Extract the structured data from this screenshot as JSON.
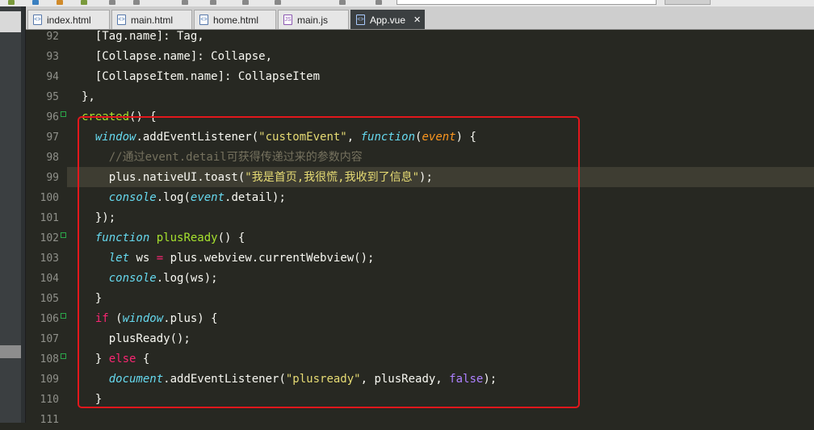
{
  "tabs": [
    {
      "label": "index.html",
      "kind": "html"
    },
    {
      "label": "main.html",
      "kind": "html"
    },
    {
      "label": "home.html",
      "kind": "html"
    },
    {
      "label": "main.js",
      "kind": "js"
    },
    {
      "label": "App.vue",
      "kind": "vue",
      "active": true
    }
  ],
  "close_glyph": "✕",
  "colors": {
    "background": "#272822",
    "keyword": "#f92672",
    "string": "#e6db74",
    "function_name": "#a6e22e",
    "builtin_italic": "#66d9ef",
    "parameter": "#fd971f",
    "comment": "#75715e",
    "boolean": "#ae81ff",
    "annotation_box": "#e3171c",
    "fold_marker": "#2ba84a"
  },
  "editor": {
    "highlighted_line": "99",
    "lines": [
      {
        "num": "92",
        "segs": [
          {
            "t": "  [Tag.name]: Tag,",
            "c": ""
          }
        ]
      },
      {
        "num": "93",
        "segs": [
          {
            "t": "  [Collapse.name]: Collapse,",
            "c": ""
          }
        ]
      },
      {
        "num": "94",
        "segs": [
          {
            "t": "  [CollapseItem.name]: CollapseItem",
            "c": ""
          }
        ]
      },
      {
        "num": "95",
        "segs": [
          {
            "t": "},",
            "c": ""
          }
        ]
      },
      {
        "num": "96",
        "fold": true,
        "segs": [
          {
            "t": "created",
            "c": "fn"
          },
          {
            "t": "() {",
            "c": ""
          }
        ]
      },
      {
        "num": "97",
        "fold": false,
        "segs": [
          {
            "t": "  ",
            "c": ""
          },
          {
            "t": "window",
            "c": "it"
          },
          {
            "t": ".addEventListener(",
            "c": ""
          },
          {
            "t": "\"customEvent\"",
            "c": "st"
          },
          {
            "t": ", ",
            "c": ""
          },
          {
            "t": "function",
            "c": "it"
          },
          {
            "t": "(",
            "c": ""
          },
          {
            "t": "event",
            "c": "pa"
          },
          {
            "t": ") {",
            "c": ""
          }
        ]
      },
      {
        "num": "98",
        "segs": [
          {
            "t": "    ",
            "c": ""
          },
          {
            "t": "//通过event.detail可获得传递过来的参数内容",
            "c": "co"
          }
        ]
      },
      {
        "num": "99",
        "segs": [
          {
            "t": "    plus.nativeUI.toast(",
            "c": ""
          },
          {
            "t": "\"我是首页,我很慌,我收到了信息\"",
            "c": "st"
          },
          {
            "t": ");",
            "c": ""
          }
        ]
      },
      {
        "num": "100",
        "segs": [
          {
            "t": "    ",
            "c": ""
          },
          {
            "t": "console",
            "c": "it"
          },
          {
            "t": ".log(",
            "c": ""
          },
          {
            "t": "event",
            "c": "it"
          },
          {
            "t": ".detail);",
            "c": ""
          }
        ]
      },
      {
        "num": "101",
        "segs": [
          {
            "t": "  });",
            "c": ""
          }
        ]
      },
      {
        "num": "102",
        "fold": true,
        "segs": [
          {
            "t": "  ",
            "c": ""
          },
          {
            "t": "function",
            "c": "it"
          },
          {
            "t": " ",
            "c": ""
          },
          {
            "t": "plusReady",
            "c": "fn"
          },
          {
            "t": "() {",
            "c": ""
          }
        ]
      },
      {
        "num": "103",
        "segs": [
          {
            "t": "    ",
            "c": ""
          },
          {
            "t": "let",
            "c": "it"
          },
          {
            "t": " ws ",
            "c": ""
          },
          {
            "t": "=",
            "c": "kw"
          },
          {
            "t": " plus.webview.currentWebview();",
            "c": ""
          }
        ]
      },
      {
        "num": "104",
        "segs": [
          {
            "t": "    ",
            "c": ""
          },
          {
            "t": "console",
            "c": "it"
          },
          {
            "t": ".log(ws);",
            "c": ""
          }
        ]
      },
      {
        "num": "105",
        "segs": [
          {
            "t": "  }",
            "c": ""
          }
        ]
      },
      {
        "num": "106",
        "fold": true,
        "segs": [
          {
            "t": "  ",
            "c": ""
          },
          {
            "t": "if",
            "c": "kw"
          },
          {
            "t": " (",
            "c": ""
          },
          {
            "t": "window",
            "c": "it"
          },
          {
            "t": ".plus) {",
            "c": ""
          }
        ]
      },
      {
        "num": "107",
        "segs": [
          {
            "t": "    plusReady();",
            "c": ""
          }
        ]
      },
      {
        "num": "108",
        "fold": true,
        "segs": [
          {
            "t": "  } ",
            "c": ""
          },
          {
            "t": "else",
            "c": "kw"
          },
          {
            "t": " {",
            "c": ""
          }
        ]
      },
      {
        "num": "109",
        "segs": [
          {
            "t": "    ",
            "c": ""
          },
          {
            "t": "document",
            "c": "it"
          },
          {
            "t": ".addEventListener(",
            "c": ""
          },
          {
            "t": "\"plusready\"",
            "c": "st"
          },
          {
            "t": ", plusReady, ",
            "c": ""
          },
          {
            "t": "false",
            "c": "bo"
          },
          {
            "t": ");",
            "c": ""
          }
        ]
      },
      {
        "num": "110",
        "segs": [
          {
            "t": "  }",
            "c": ""
          }
        ]
      },
      {
        "num": "111",
        "segs": []
      }
    ]
  }
}
